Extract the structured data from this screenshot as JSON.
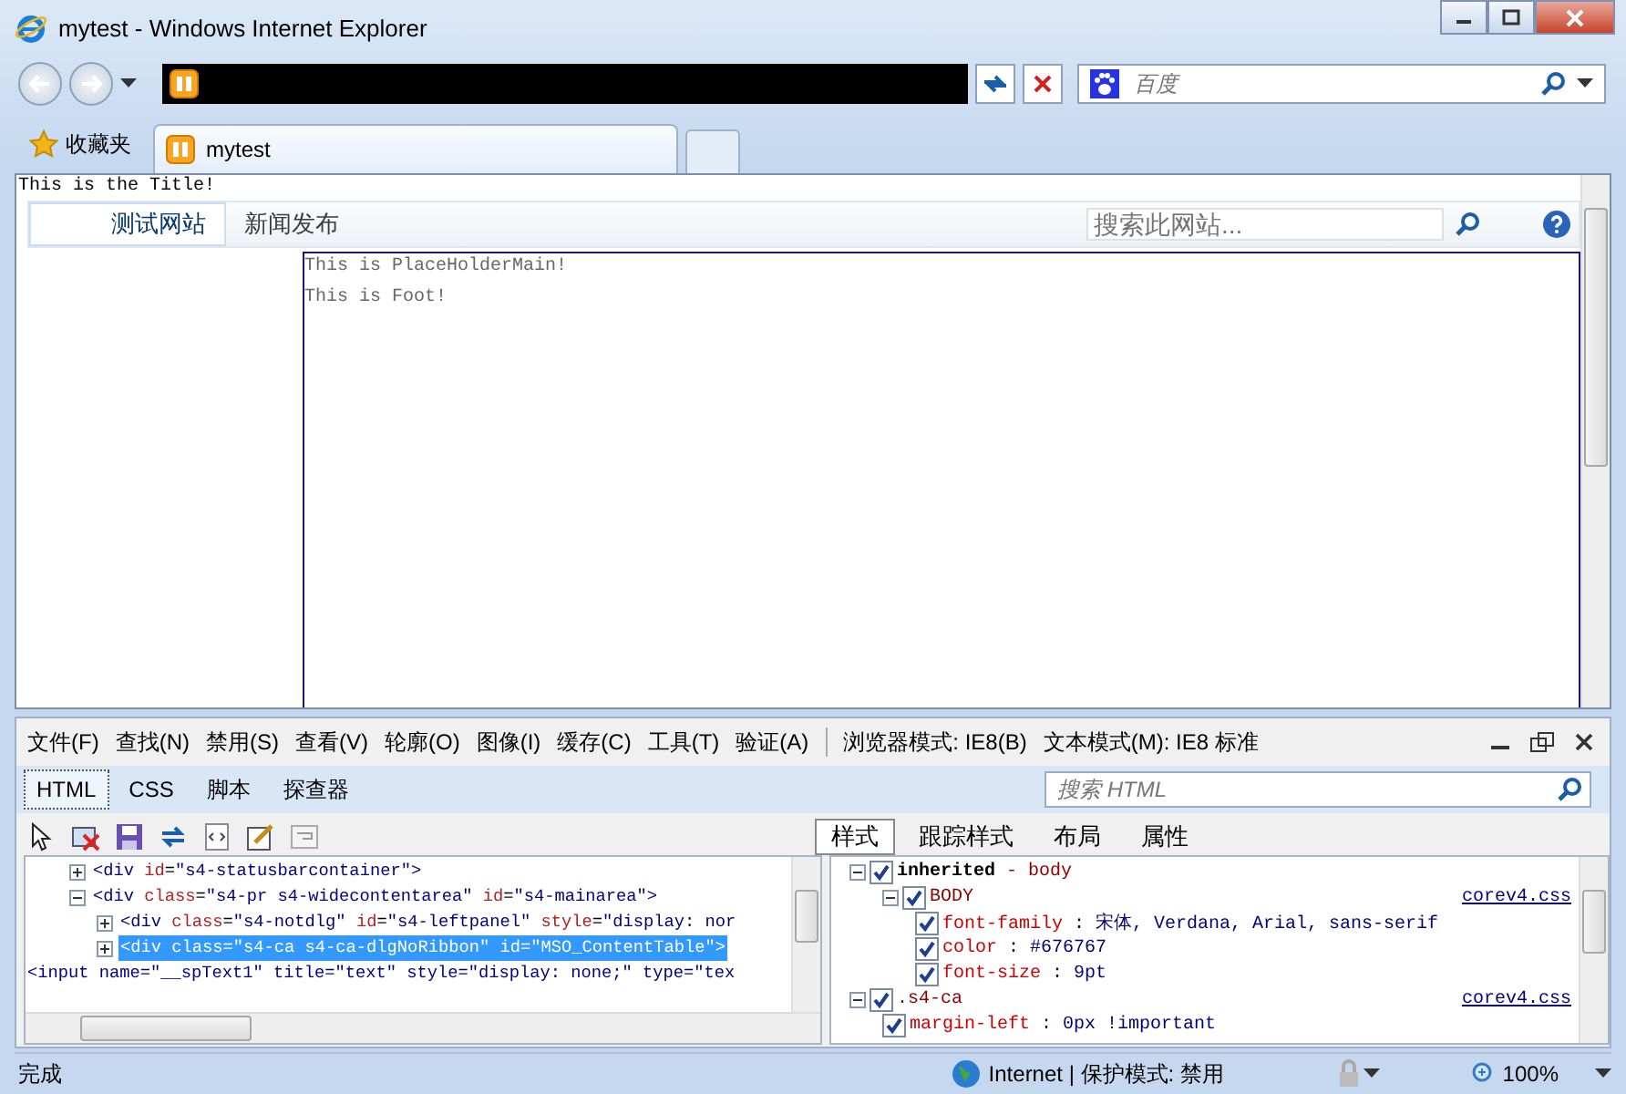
{
  "window": {
    "title": "mytest - Windows Internet Explorer"
  },
  "nav": {
    "search_placeholder": "百度"
  },
  "favorites": {
    "label": "收藏夹"
  },
  "tabs": [
    {
      "label": "mytest",
      "selected": true
    }
  ],
  "page": {
    "title_text": "This is the Title!",
    "nav_items": [
      {
        "label": "测试网站",
        "selected": true
      },
      {
        "label": "新闻发布",
        "selected": false
      }
    ],
    "search_placeholder": "搜索此网站...",
    "content_lines": [
      "This is PlaceHolderMain!",
      "This is Foot!"
    ]
  },
  "devtools": {
    "menu": [
      "文件(F)",
      "查找(N)",
      "禁用(S)",
      "查看(V)",
      "轮廓(O)",
      "图像(I)",
      "缓存(C)",
      "工具(T)",
      "验证(A)"
    ],
    "modes": [
      "浏览器模式: IE8(B)",
      "文本模式(M): IE8 标准"
    ],
    "tabs": [
      {
        "label": "HTML",
        "selected": true
      },
      {
        "label": "CSS",
        "selected": false
      },
      {
        "label": "脚本",
        "selected": false
      },
      {
        "label": "探查器",
        "selected": false
      }
    ],
    "search_placeholder": "搜索 HTML",
    "side_tabs": [
      {
        "label": "样式",
        "selected": true
      },
      {
        "label": "跟踪样式",
        "selected": false
      },
      {
        "label": "布局",
        "selected": false
      },
      {
        "label": "属性",
        "selected": false
      }
    ],
    "dom": [
      {
        "text": "<div id=\"s4-statusbarcontainer\">",
        "expanded": false,
        "selected": false
      },
      {
        "text": "<div class=\"s4-pr s4-widecontentarea\" id=\"s4-mainarea\">",
        "expanded": true,
        "selected": false,
        "children": [
          {
            "text": "<div class=\"s4-notdlg\" id=\"s4-leftpanel\" style=\"display: nor",
            "expanded": false,
            "selected": false
          },
          {
            "text": "<div class=\"s4-ca s4-ca-dlgNoRibbon\" id=\"MSO_ContentTable\">",
            "expanded": false,
            "selected": true
          }
        ]
      }
    ],
    "dom_tail": "<input name=\"__spText1\" title=\"text\" style=\"display: none;\" type=\"tex",
    "styles": [
      {
        "kind": "inherited",
        "text": "inherited - body",
        "checked": true,
        "expanded": true,
        "children": [
          {
            "kind": "rule",
            "selector": "BODY",
            "source": "corev4.css",
            "checked": true,
            "expanded": true,
            "children": [
              {
                "kind": "property",
                "text": "font-family : 宋体, Verdana, Arial, sans-serif",
                "checked": true
              },
              {
                "kind": "property",
                "text": "color : #676767",
                "checked": true
              },
              {
                "kind": "property",
                "text": "font-size : 9pt",
                "checked": true
              }
            ]
          }
        ]
      },
      {
        "kind": "rule",
        "selector": ".s4-ca",
        "source": "corev4.css",
        "checked": true,
        "expanded": true,
        "children": [
          {
            "kind": "property",
            "text": "margin-left : 0px !important",
            "checked": true
          }
        ]
      }
    ]
  },
  "status_bar": {
    "text": "完成",
    "zone": "Internet | 保护模式: 禁用",
    "zoom": "100%"
  }
}
